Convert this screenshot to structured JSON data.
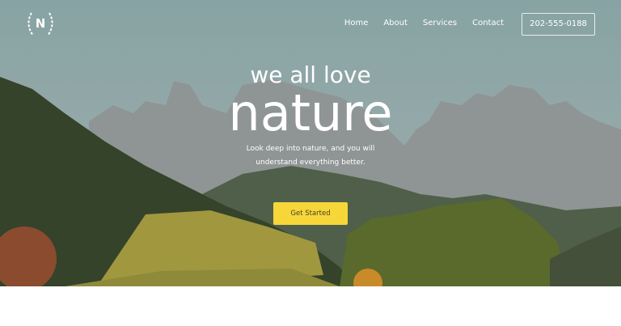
{
  "nav": {
    "logo_letter": "N",
    "links": [
      "Home",
      "About",
      "Services",
      "Contact"
    ],
    "phone": "202-555-0188"
  },
  "hero": {
    "kicker": "we all love",
    "title": "nature",
    "subtitle_line1": "Look deep into nature, and you will",
    "subtitle_line2": "understand everything better.",
    "cta": "Get Started"
  },
  "colors": {
    "accent": "#f7d63a"
  }
}
